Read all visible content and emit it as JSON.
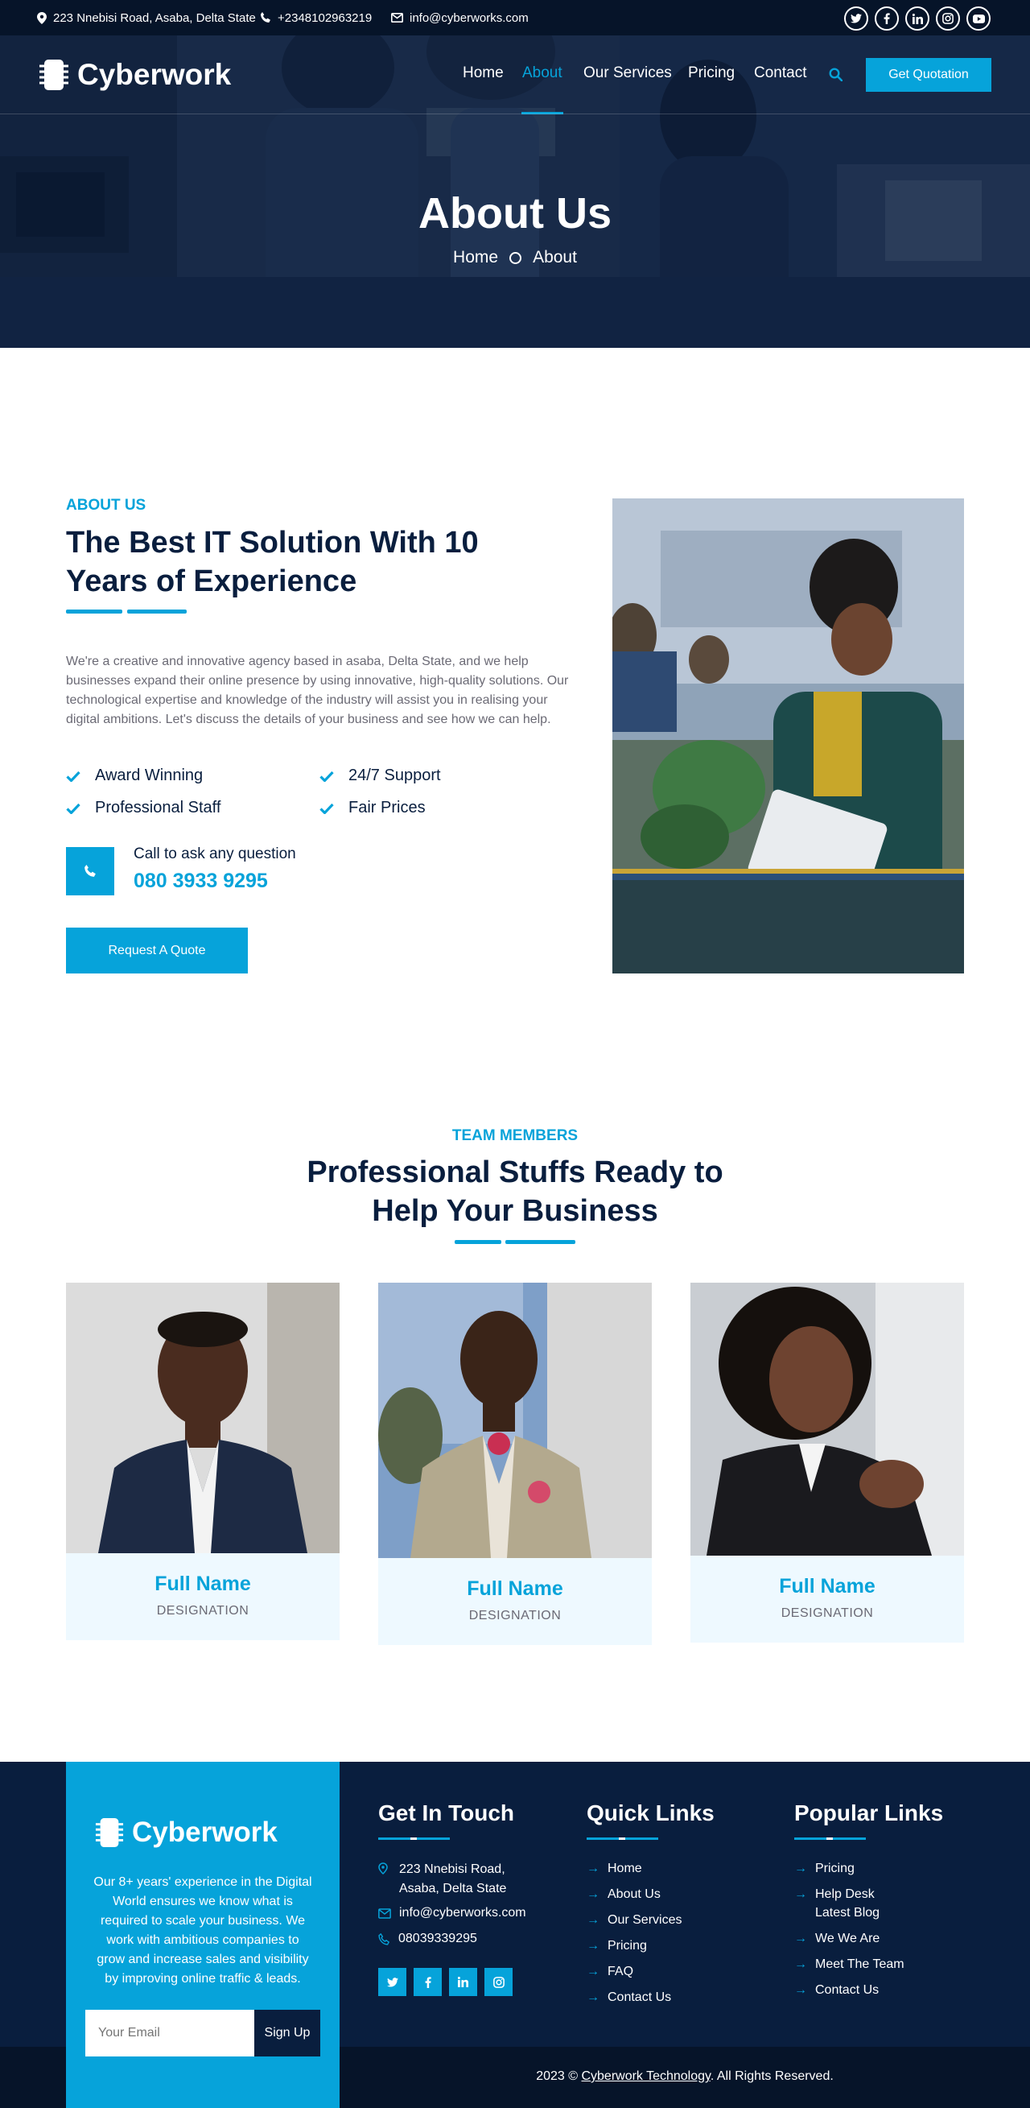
{
  "topbar": {
    "address": "223 Nnebisi Road, Asaba, Delta State",
    "phone": "+2348102963219",
    "email": "info@cyberworks.com",
    "social_icons": [
      "twitter-icon",
      "facebook-icon",
      "linkedin-icon",
      "instagram-icon",
      "youtube-icon"
    ]
  },
  "brand": {
    "name": "Cyberwork",
    "accent": "#06a3da",
    "dark": "#091e3e"
  },
  "nav": {
    "items": [
      "Home",
      "About",
      "Our Services",
      "Pricing",
      "Contact"
    ],
    "active": "About",
    "cta": "Get Quotation"
  },
  "hero": {
    "title": "About Us",
    "crumb_home": "Home",
    "crumb_current": "About"
  },
  "about": {
    "eyebrow": "ABOUT US",
    "title_line1": "The Best IT Solution With 10",
    "title_line2": "Years of Experience",
    "paragraph": "We're a creative and innovative agency based in asaba, Delta State, and we help businesses expand their online presence by using innovative, high-quality solutions. Our technological expertise and knowledge of the industry will assist you in realising your digital ambitions. Let's discuss the details of your business and see how we can help.",
    "features": [
      "Award Winning",
      "24/7 Support",
      "Professional Staff",
      "Fair Prices"
    ],
    "call_label": "Call to ask any question",
    "call_number": "080 3933 9295",
    "button": "Request A Quote"
  },
  "team": {
    "eyebrow": "TEAM MEMBERS",
    "title_line1": "Professional Stuffs Ready to",
    "title_line2": "Help Your Business",
    "members": [
      {
        "name": "Full Name",
        "designation": "DESIGNATION"
      },
      {
        "name": "Full Name",
        "designation": "DESIGNATION"
      },
      {
        "name": "Full Name",
        "designation": "DESIGNATION"
      }
    ]
  },
  "footer": {
    "brand_name": "Cyberwork",
    "about_l1": "Our 8+ years' experience in the Digital",
    "about_l2": "World ensures we know what is",
    "about_l3": "required to scale your business. We",
    "about_l4": "work with ambitious companies to",
    "about_l5": "grow and increase sales and visibility",
    "about_l6": "by improving online traffic & leads.",
    "email_placeholder": "Your Email",
    "signup": "Sign Up",
    "contact_title": "Get In Touch",
    "contact_addr_l1": "223 Nnebisi Road,",
    "contact_addr_l2": "Asaba, Delta State",
    "contact_email": "info@cyberworks.com",
    "contact_phone": "08039339295",
    "social_icons": [
      "twitter-icon",
      "facebook-icon",
      "linkedin-icon",
      "instagram-icon"
    ],
    "quick_title": "Quick Links",
    "quick_links": [
      "Home",
      "About Us",
      "Our Services",
      "Pricing",
      "FAQ",
      "Contact Us"
    ],
    "popular_title": "Popular Links",
    "popular_links": [
      "Pricing",
      "Help Desk",
      "Latest Blog",
      "We We Are",
      "Meet The Team",
      "Contact Us"
    ],
    "copyright_prefix": "2023 © ",
    "copyright_link": "Cyberwork Technology",
    "copyright_suffix": ". All Rights Reserved."
  }
}
